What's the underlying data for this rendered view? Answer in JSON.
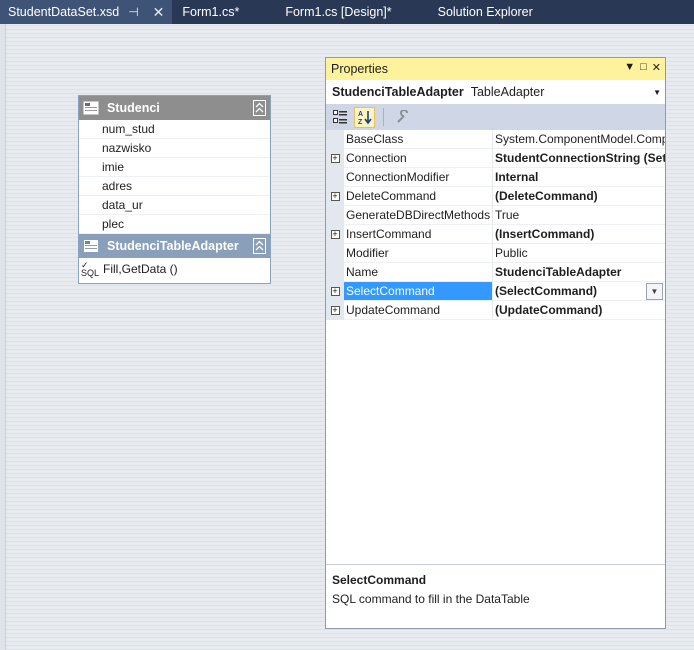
{
  "tabs": [
    {
      "label": "StudentDataSet.xsd",
      "active": true,
      "pin": "⊣",
      "close": "✕"
    },
    {
      "label": "Form1.cs*"
    },
    {
      "label": "Form1.cs [Design]*"
    },
    {
      "label": "Solution Explorer"
    }
  ],
  "table": {
    "title": "Studenci",
    "columns": [
      "num_stud",
      "nazwisko",
      "imie",
      "adres",
      "data_ur",
      "plec"
    ],
    "adapter_title": "StudenciTableAdapter",
    "adapter_method": "Fill,GetData ()",
    "sql_icon_label": "SQL"
  },
  "properties": {
    "title": "Properties",
    "title_buttons": [
      "▼",
      "□",
      "✕"
    ],
    "object_name": "StudenciTableAdapter",
    "object_type": "TableAdapter",
    "rows": [
      {
        "name": "BaseClass",
        "value": "System.ComponentModel.Component",
        "expandable": false,
        "bold": false
      },
      {
        "name": "Connection",
        "value": "StudentConnectionString (Settings)",
        "expandable": true,
        "bold": true
      },
      {
        "name": "ConnectionModifier",
        "value": "Internal",
        "expandable": false,
        "bold": true
      },
      {
        "name": "DeleteCommand",
        "value": "(DeleteCommand)",
        "expandable": true,
        "bold": true
      },
      {
        "name": "GenerateDBDirectMethods",
        "value": "True",
        "expandable": false,
        "bold": false
      },
      {
        "name": "InsertCommand",
        "value": "(InsertCommand)",
        "expandable": true,
        "bold": true
      },
      {
        "name": "Modifier",
        "value": "Public",
        "expandable": false,
        "bold": false
      },
      {
        "name": "Name",
        "value": "StudenciTableAdapter",
        "expandable": false,
        "bold": true
      },
      {
        "name": "SelectCommand",
        "value": "(SelectCommand)",
        "expandable": true,
        "bold": true,
        "selected": true
      },
      {
        "name": "UpdateCommand",
        "value": "(UpdateCommand)",
        "expandable": true,
        "bold": true
      }
    ],
    "description_title": "SelectCommand",
    "description_text": "SQL command to fill in the DataTable"
  },
  "colors": {
    "tabstrip": "#293955",
    "properties_title": "#fff29d",
    "selection": "#3399ff"
  }
}
